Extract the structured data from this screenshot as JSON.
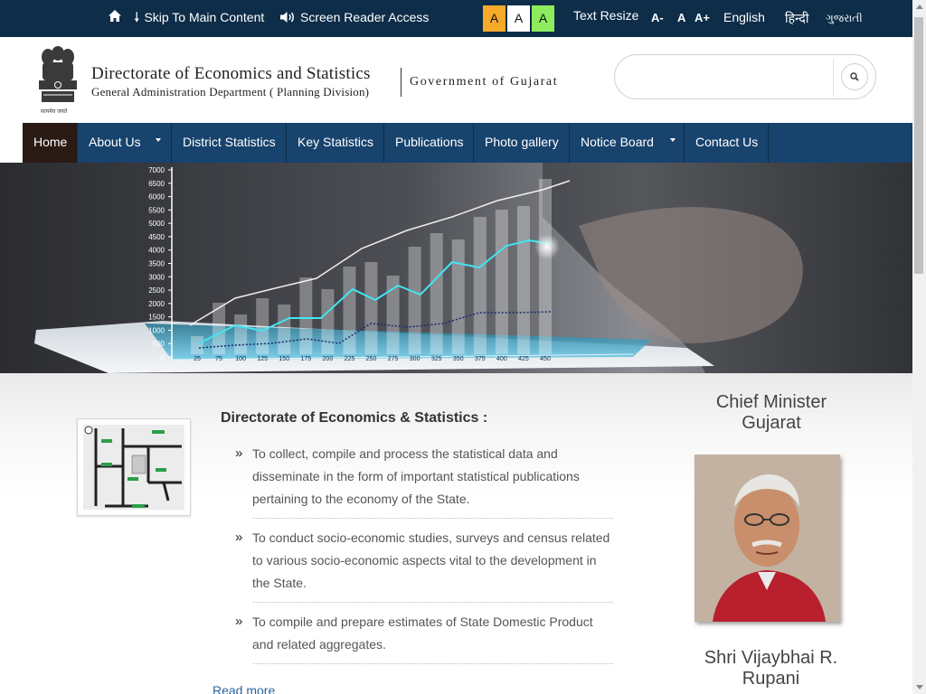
{
  "topbar": {
    "home_icon": "home-icon",
    "skip_label": "Skip To Main Content",
    "skip_icon": "arrow-down-icon",
    "screen_reader_label": "Screen Reader Access",
    "screen_reader_icon": "speaker-icon",
    "contrast_options": [
      "A",
      "A",
      "A"
    ],
    "contrast_colors": [
      "#f7a92a",
      "#ffffff",
      "#8dec5c"
    ],
    "text_resize_label": "Text Resize",
    "resize_decrease": "A-",
    "resize_normal": "A",
    "resize_increase": "A+",
    "languages": [
      "English",
      "हिन्दी",
      "ગુજરાતી"
    ]
  },
  "header": {
    "title": "Directorate of Economics and Statistics",
    "subtitle": "General Administration Department ( Planning Division)",
    "government": "Government of Gujarat",
    "emblem_caption": "सत्यमेव जयते",
    "emblem_icon": "state-emblem-icon",
    "search": {
      "placeholder": "",
      "value": "",
      "button_icon": "search-icon"
    }
  },
  "nav": {
    "items": [
      {
        "label": "Home",
        "active": true,
        "dropdown": false
      },
      {
        "label": "About Us",
        "active": false,
        "dropdown": true
      },
      {
        "label": "District Statistics",
        "active": false,
        "dropdown": false
      },
      {
        "label": "Key Statistics",
        "active": false,
        "dropdown": false
      },
      {
        "label": "Publications",
        "active": false,
        "dropdown": false
      },
      {
        "label": "Photo gallery",
        "active": false,
        "dropdown": false
      },
      {
        "label": "Notice Board",
        "active": false,
        "dropdown": true
      },
      {
        "label": "Contact Us",
        "active": false,
        "dropdown": false
      }
    ]
  },
  "banner": {
    "y_ticks": [
      "7000",
      "6500",
      "6000",
      "5500",
      "5000",
      "4500",
      "4000",
      "3500",
      "3000",
      "2500",
      "2000",
      "1500",
      "1000",
      "500",
      "0"
    ],
    "x_ticks": [
      "25",
      "75",
      "100",
      "125",
      "150",
      "175",
      "200",
      "225",
      "250",
      "275",
      "300",
      "325",
      "350",
      "375",
      "400",
      "425",
      "450"
    ]
  },
  "main": {
    "map_icon": "location-map-icon",
    "content_title": "Directorate of Economics & Statistics :",
    "bullets": [
      "To collect, compile and process the statistical data and disseminate in the form of important statistical publications pertaining to the economy of the State.",
      "To conduct socio-economic studies, surveys and census related to various socio-economic aspects vital to the development in the State.",
      "To compile and prepare estimates of State Domestic Product and related aggregates."
    ],
    "read_more": "Read more"
  },
  "chief_minister": {
    "title": "Chief Minister Gujarat",
    "name": "Shri Vijaybhai R. Rupani",
    "photo_icon": "portrait-photo"
  }
}
